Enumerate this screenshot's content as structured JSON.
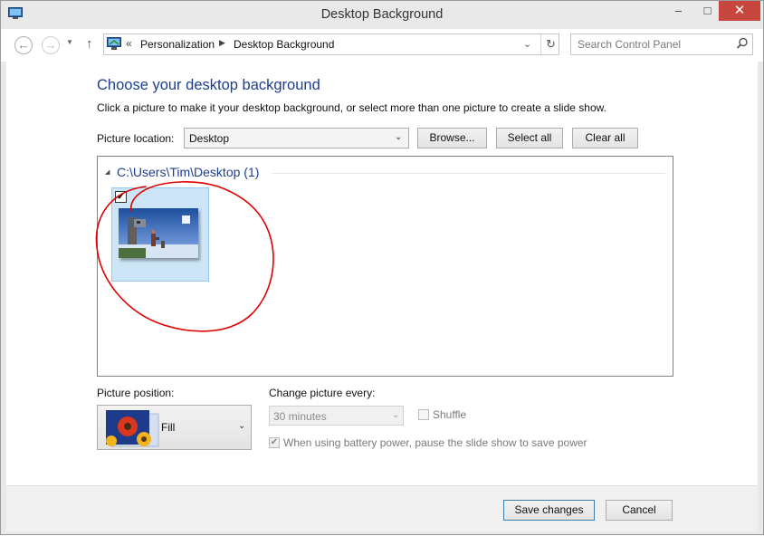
{
  "window": {
    "title": "Desktop Background",
    "minimize_glyph": "–",
    "maximize_glyph": "□",
    "close_glyph": "✕"
  },
  "nav": {
    "back_glyph": "←",
    "forward_glyph": "→",
    "dropdown_glyph": "▼",
    "up_glyph": "↑",
    "breadcrumb_overflow": "«",
    "breadcrumbs": [
      "Personalization",
      "Desktop Background"
    ],
    "breadcrumb_separator": "▶",
    "address_dropdown_glyph": "⌄",
    "refresh_glyph": "↻",
    "search_placeholder": "Search Control Panel"
  },
  "main": {
    "heading": "Choose your desktop background",
    "description": "Click a picture to make it your desktop background, or select more than one picture to create a slide show.",
    "picture_location_label": "Picture location:",
    "picture_location_value": "Desktop",
    "dropdown_arrow": "⌄",
    "browse_label": "Browse...",
    "select_all_label": "Select all",
    "clear_all_label": "Clear all",
    "group_toggle_glyph": "◢",
    "group_label": "C:\\Users\\Tim\\Desktop (1)",
    "thumbnails": [
      {
        "checked": true,
        "check_glyph": "✔"
      }
    ]
  },
  "options": {
    "picture_position_label": "Picture position:",
    "picture_position_value": "Fill",
    "change_picture_label": "Change picture every:",
    "interval_value": "30 minutes",
    "shuffle_label": "Shuffle",
    "shuffle_checked": false,
    "battery_label": "When using battery power, pause the slide show to save power",
    "battery_checked": true,
    "battery_check_glyph": "✔"
  },
  "footer": {
    "save_label": "Save changes",
    "cancel_label": "Cancel"
  },
  "colors": {
    "heading": "#1e3d8f",
    "close_button": "#c7473e",
    "selection_tile": "#cde6f7",
    "annotation": "#e00000"
  }
}
